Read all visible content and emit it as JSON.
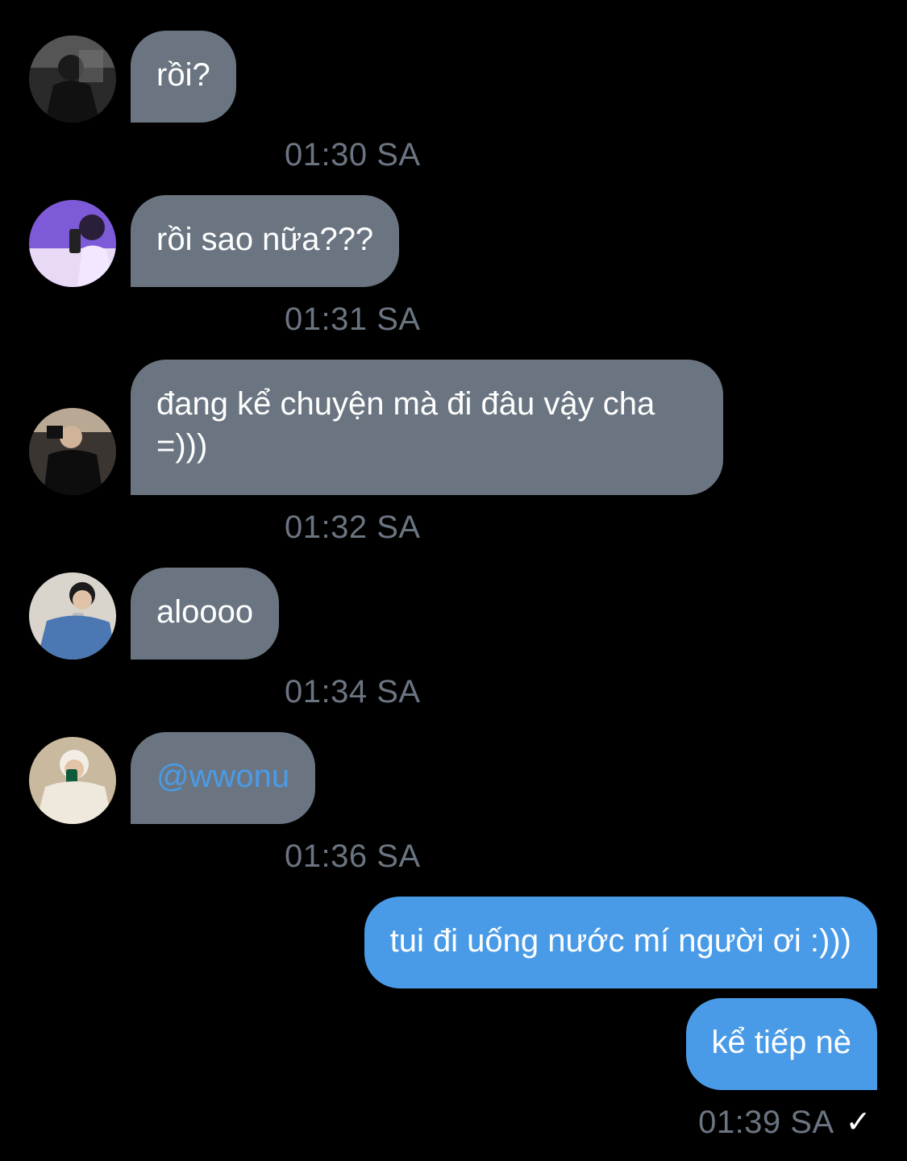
{
  "messages": [
    {
      "text": "rồi?",
      "time": "01:30 SA",
      "avatar": "avatar-1"
    },
    {
      "text": "rồi sao nữa???",
      "time": "01:31 SA",
      "avatar": "avatar-2"
    },
    {
      "text": "đang kể chuyện mà đi đâu vậy cha =)))",
      "time": "01:32 SA",
      "avatar": "avatar-3"
    },
    {
      "text": "aloooo",
      "time": "01:34 SA",
      "avatar": "avatar-4"
    },
    {
      "text": "@wwonu",
      "time": "01:36 SA",
      "avatar": "avatar-5"
    }
  ],
  "outgoing": [
    {
      "text": "tui đi uống nước mí người ơi :)))"
    },
    {
      "text": "kể tiếp nè"
    }
  ],
  "outgoing_time": "01:39 SA",
  "read_receipt_icon": "✓",
  "colors": {
    "incoming_bubble": "#6b7581",
    "outgoing_bubble": "#4a9be7",
    "mention": "#4a9be7",
    "timestamp": "#6b7581",
    "background": "#000000"
  }
}
